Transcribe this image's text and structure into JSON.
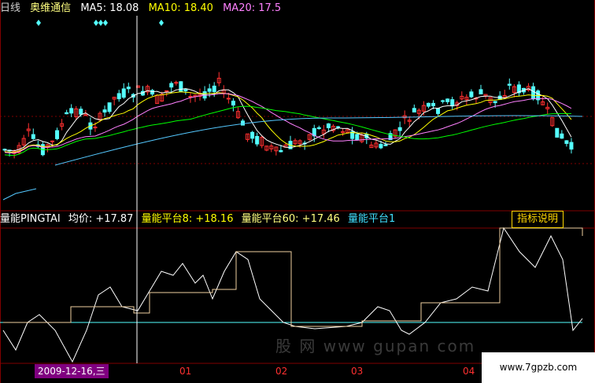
{
  "header": {
    "period": "日线",
    "stock_name": "奥维通信",
    "ma5": "MA5: 18.08",
    "ma10": "MA10: 18.40",
    "ma20": "MA20: 17.5",
    "colors": {
      "period": "#d0d0d0",
      "stock_name": "#ffff80",
      "ma5": "#ffffff",
      "ma10": "#ffff00",
      "ma20": "#ff80ff"
    }
  },
  "indicator": {
    "name": "量能PINGTAI",
    "avg": "均价: +17.87",
    "platform8": "量能平台8: +18.16",
    "platform60": "量能平台60: +17.46",
    "platform1": "量能平台1",
    "help_button": "指标说明",
    "colors": {
      "name": "#ffffff",
      "avg": "#ffffff",
      "platform8": "#ffff00",
      "platform60": "#ffff80",
      "platform1": "#40e0ff"
    }
  },
  "x_axis": {
    "cursor_date": "2009-12-16,三",
    "months": [
      "01",
      "02",
      "03",
      "04"
    ]
  },
  "watermark": {
    "site": "www.7gpzb.com",
    "faint_text": "股 网 www gupan com"
  },
  "colors": {
    "up_candle": "#ff3030",
    "down_candle": "#54ffff",
    "ma5": "#ffffff",
    "ma10": "#ffff00",
    "ma20": "#ff80ff",
    "ma60": "#00ff00",
    "long_ma": "#54c8ff",
    "indicator_line": "#ffffff",
    "platform_line": "#f0d0a0",
    "baseline": "#54ffff",
    "grid": "#800000",
    "crosshair": "#ffffff"
  }
}
